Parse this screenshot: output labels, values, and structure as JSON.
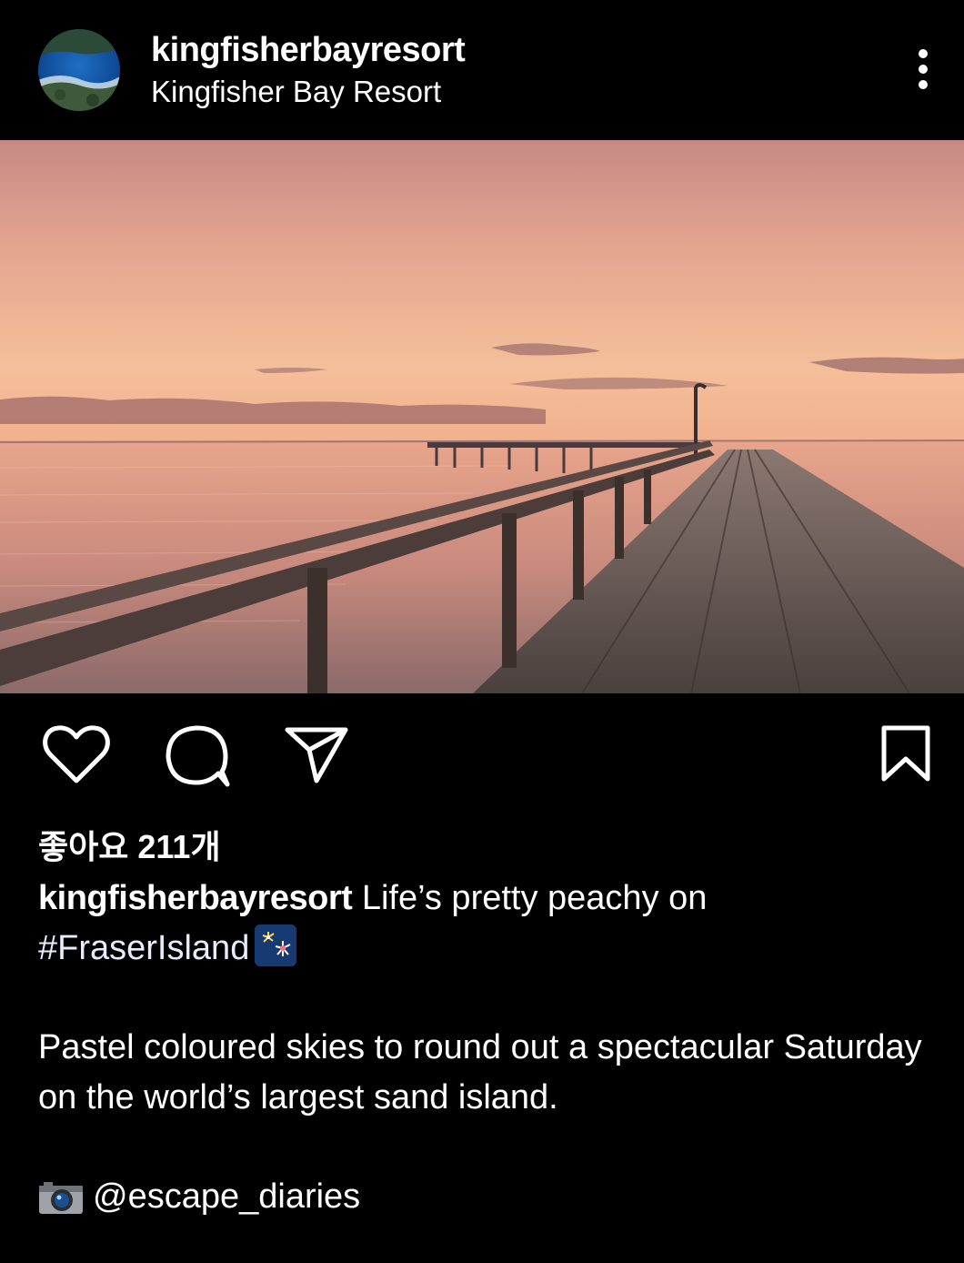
{
  "post": {
    "username": "kingfisherbayresort",
    "location": "Kingfisher Bay Resort"
  },
  "likes": {
    "text": "좋아요 211개"
  },
  "caption": {
    "username": "kingfisherbayresort",
    "text": " Life’s pretty peachy on ",
    "hashtag": "#FraserIsland",
    "emoji": "fireworks-emoji"
  },
  "description": {
    "text": "Pastel coloured skies to round out a spectacular Saturday on the world’s largest sand island."
  },
  "credit": {
    "icon": "camera-icon",
    "handle": "@escape_diaries"
  },
  "icons": {
    "like": "heart-icon",
    "comment": "comment-bubble-icon",
    "share": "paper-plane-icon",
    "save": "bookmark-icon",
    "more": "more-options-icon"
  },
  "colors": {
    "background": "#000000",
    "text": "#ffffff"
  }
}
